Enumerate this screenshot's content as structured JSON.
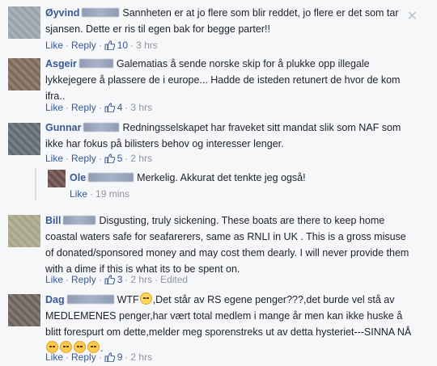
{
  "comments": [
    {
      "author": "Øyvind",
      "text": "Sannheten er at jo flere som blir reddet, jo flere er det som tar sjansen. Dette er ris til egen bak for begge parter!!",
      "like": "Like",
      "reply": "Reply",
      "likes": "10",
      "time": "3 hrs",
      "avatar_color": "#9aa3ad"
    },
    {
      "author": "Asgeir",
      "text": "Galematias å sende norske skip for å plukke opp illegale lykkejegere å plassere de i europe... Hadde de isteden retunert de hvor de kom ifra..",
      "like": "Like",
      "reply": "Reply",
      "likes": "4",
      "time": "3 hrs",
      "avatar_color": "#7d6a58"
    },
    {
      "author": "Gunnar",
      "text": "Redningsselskapet har fraveket sitt mandat slik som NAF som ikke har fokus på bilisters behov og interesser lenger.",
      "like": "Like",
      "reply": "Reply",
      "likes": "5",
      "time": "2 hrs",
      "avatar_color": "#5f6a72"
    },
    {
      "author": "Ole",
      "text": "Merkelig. Akkurat det tenkte jeg også!",
      "like": "Like",
      "time": "19 mins",
      "avatar_color": "#6b4e4a"
    },
    {
      "author": "Bill",
      "text": "Disgusting, truly sickening. These boats are there to keep home coastal waters safe for seafarerers, same as RNLI in UK . This is a gross misuse of donated/sponsored money and may cost them dearly. I will never provide them with a dime if this is what its to be spent on.",
      "like": "Like",
      "reply": "Reply",
      "likes": "3",
      "time": "2 hrs",
      "edited": "Edited",
      "avatar_color": "#a8a58a"
    },
    {
      "author": "Dag",
      "text_before": "WTF",
      "text_after": ",Det står av RS egene penger???,det burde vel stå av MEDLEMENES penger,har vært total medlem i mange år men kan ikke huske å blitt forespurt om dette,melder meg sporenstreks ut av detta hysteriet---SINNA NÅ",
      "text_end": ".",
      "like": "Like",
      "reply": "Reply",
      "likes": "9",
      "time": "2 hrs",
      "avatar_color": "#6d625c"
    }
  ],
  "icons": {
    "close": "close-icon",
    "like": "thumbs-up-icon",
    "emoji_smirk": "unamused-face-emoji",
    "emoji_angry": "angry-face-emoji"
  },
  "colors": {
    "link": "#365899",
    "meta": "#90949c",
    "background": "#f6f7f9"
  }
}
